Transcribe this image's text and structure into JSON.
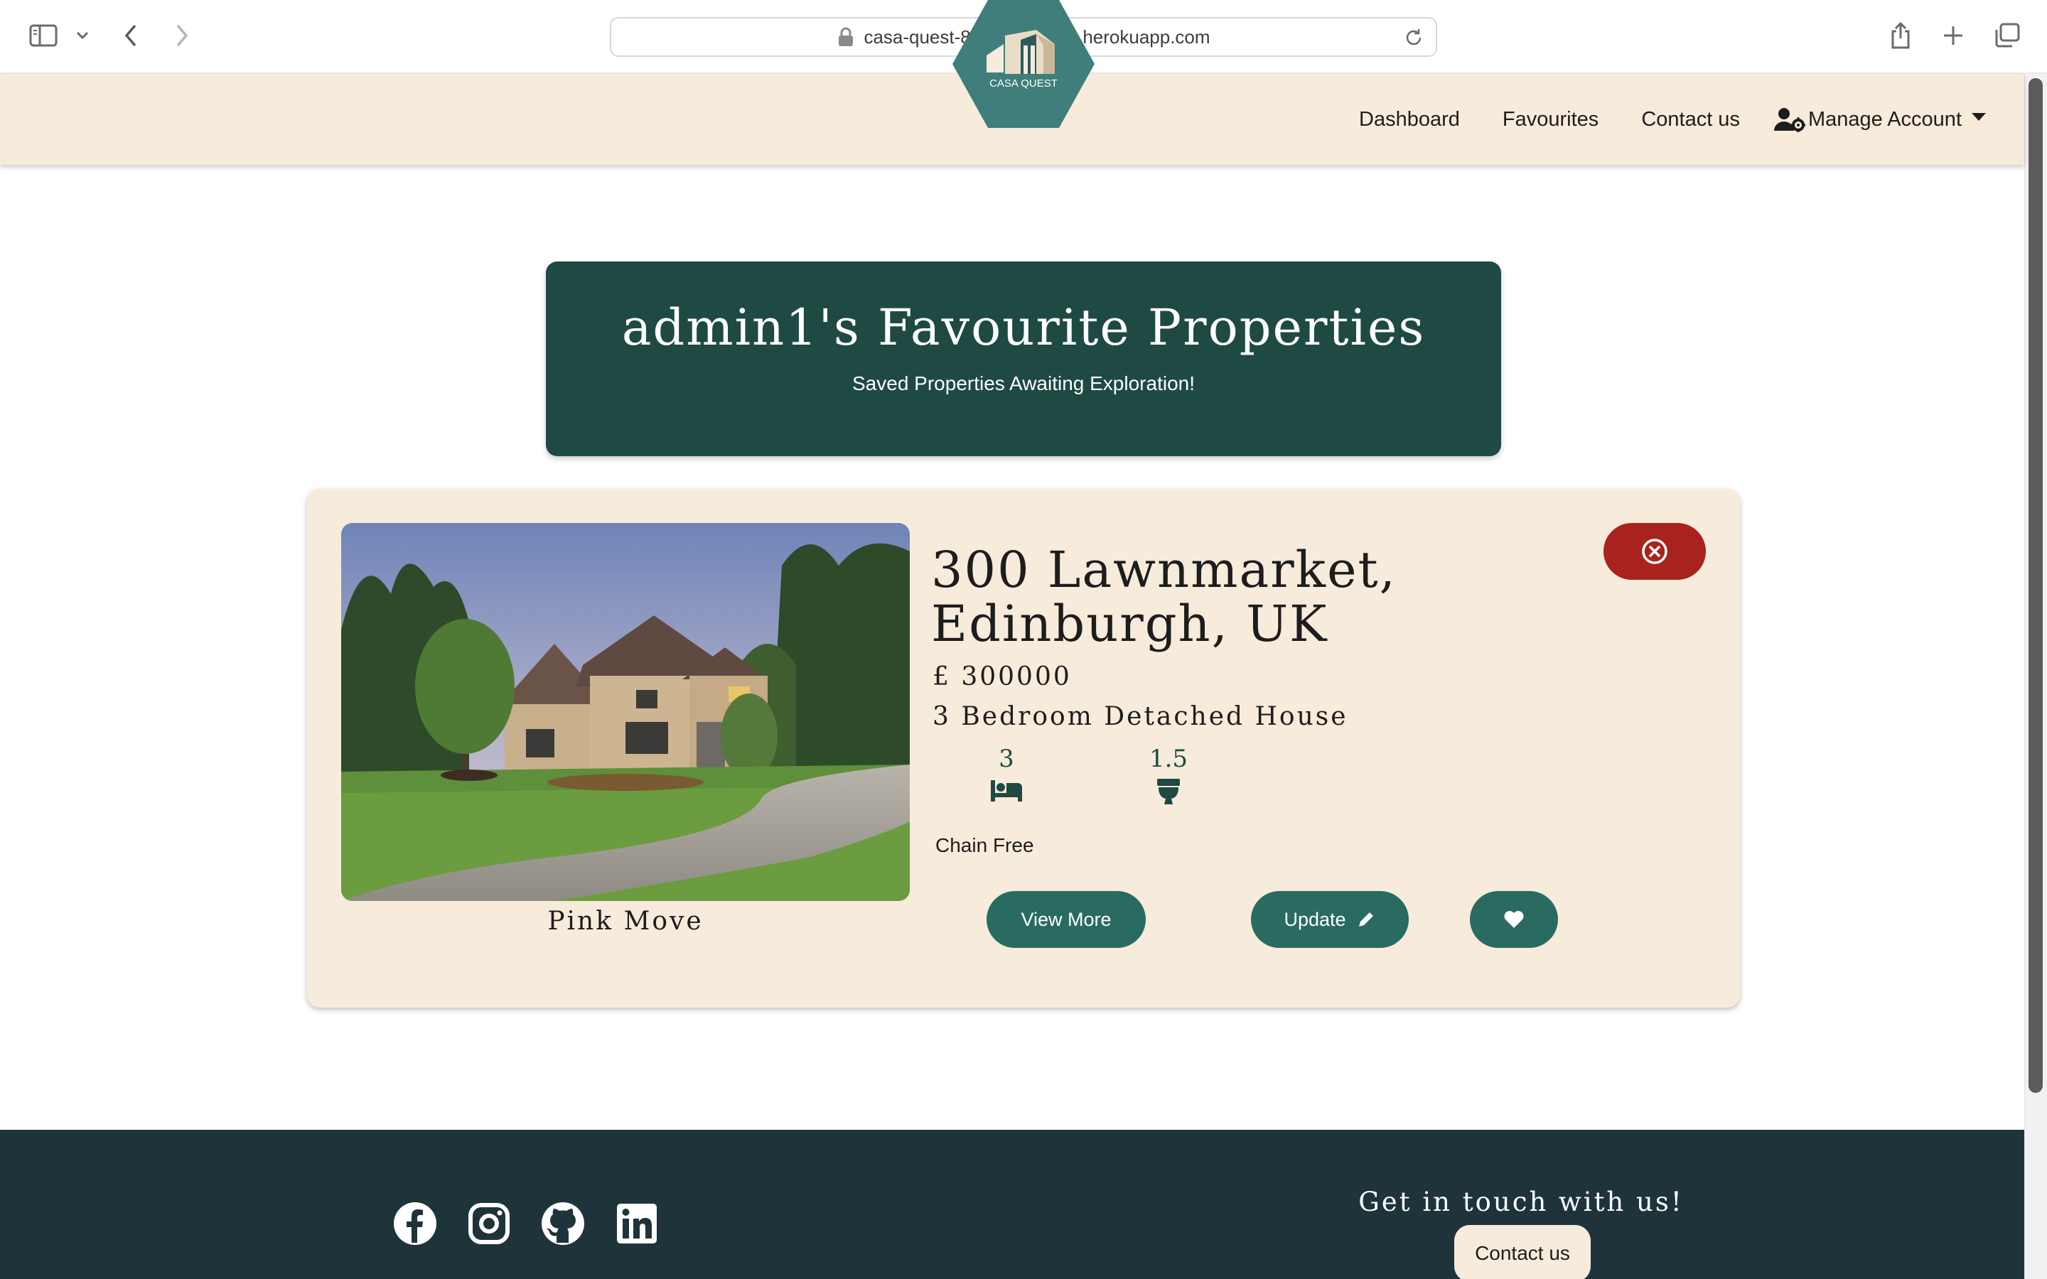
{
  "browser": {
    "url": "casa-quest-853d4c81f9b1.herokuapp.com"
  },
  "nav": {
    "logo_text": "CASA QUEST",
    "links": [
      "Dashboard",
      "Favourites",
      "Contact us"
    ],
    "manage_account": "Manage Account"
  },
  "banner": {
    "title": "admin1's Favourite Properties",
    "subtitle": "Saved Properties Awaiting Exploration!"
  },
  "property": {
    "address": "300 Lawnmarket, Edinburgh, UK",
    "price": "£ 300000",
    "type": "3 Bedroom Detached House",
    "bedrooms": "3",
    "bathrooms": "1.5",
    "chain": "Chain Free",
    "agent": "Pink Move",
    "buttons": {
      "view_more": "View More",
      "update": "Update"
    }
  },
  "footer": {
    "heading": "Get in touch with us!",
    "contact_button": "Contact us",
    "social": [
      "facebook",
      "instagram",
      "github",
      "linkedin"
    ]
  },
  "colors": {
    "nav_bg": "#f7ebdb",
    "brand_green": "#1e4a43",
    "button_green": "#2a6b61",
    "remove_red": "#a8231e",
    "footer_bg": "#1f343a"
  }
}
